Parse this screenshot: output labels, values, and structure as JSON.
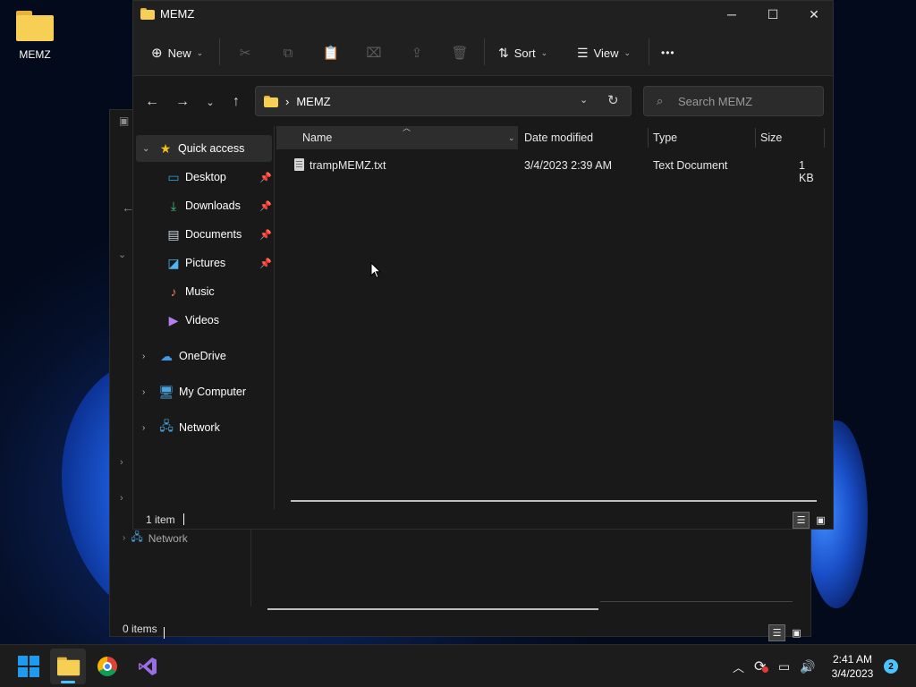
{
  "desktop": {
    "icons": [
      {
        "label": "MEMZ",
        "icon": "folder-icon"
      }
    ]
  },
  "background_window": {
    "sidebar_items": [
      {
        "label": "Network",
        "icon": "network-icon"
      }
    ],
    "status": {
      "item_count": "0 items"
    }
  },
  "window": {
    "title": "MEMZ",
    "controls": {
      "minimize": "─",
      "maximize": "☐",
      "close": "✕"
    },
    "toolbar": {
      "new_label": "New",
      "sort_label": "Sort",
      "view_label": "View",
      "more_label": "•••",
      "disabled_actions": [
        "cut",
        "copy",
        "paste",
        "rename",
        "share",
        "delete"
      ]
    },
    "address": {
      "path": [
        "MEMZ"
      ],
      "separator": "›"
    },
    "search": {
      "placeholder": "Search MEMZ"
    },
    "nav_pane": {
      "quick_access": {
        "label": "Quick access",
        "items": [
          {
            "label": "Desktop",
            "icon": "desktop-icon",
            "pinned": true
          },
          {
            "label": "Downloads",
            "icon": "downloads-icon",
            "pinned": true
          },
          {
            "label": "Documents",
            "icon": "documents-icon",
            "pinned": true
          },
          {
            "label": "Pictures",
            "icon": "pictures-icon",
            "pinned": true
          },
          {
            "label": "Music",
            "icon": "music-icon",
            "pinned": false
          },
          {
            "label": "Videos",
            "icon": "videos-icon",
            "pinned": false
          }
        ]
      },
      "roots": [
        {
          "label": "OneDrive",
          "icon": "onedrive-icon"
        },
        {
          "label": "My Computer",
          "icon": "computer-icon"
        },
        {
          "label": "Network",
          "icon": "network-icon"
        }
      ]
    },
    "columns": [
      "Name",
      "Date modified",
      "Type",
      "Size"
    ],
    "files": [
      {
        "name": "trampMEMZ.txt",
        "date_modified": "3/4/2023 2:39 AM",
        "type": "Text Document",
        "size": "1 KB"
      }
    ],
    "status": {
      "item_count": "1 item"
    }
  },
  "taskbar": {
    "apps": [
      {
        "name": "start",
        "icon": "windows-start-icon"
      },
      {
        "name": "File Explorer",
        "icon": "file-explorer-icon",
        "active": true
      },
      {
        "name": "Google Chrome",
        "icon": "chrome-icon"
      },
      {
        "name": "Visual Studio",
        "icon": "visual-studio-icon"
      }
    ],
    "tray": {
      "time": "2:41 AM",
      "date": "3/4/2023",
      "notifications": "2"
    }
  },
  "colors": {
    "window_bg": "#191919",
    "titlebar_bg": "#202020",
    "accent": "#4cc2ff",
    "folder_yellow": "#f8cf55"
  }
}
